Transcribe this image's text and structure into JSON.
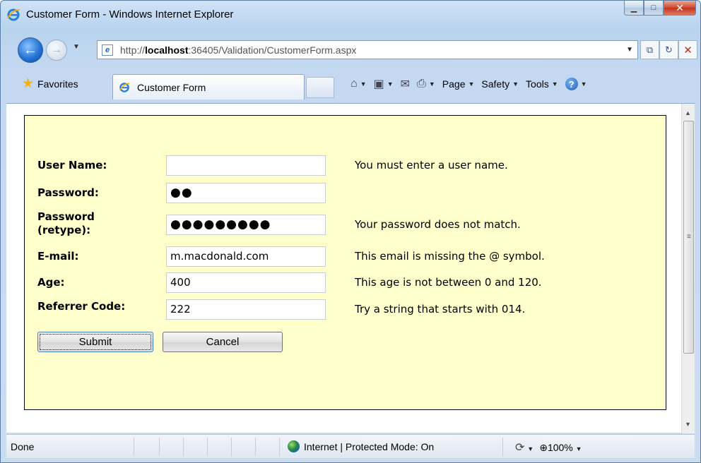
{
  "window": {
    "title": "Customer Form - Windows Internet Explorer"
  },
  "address_bar": {
    "url_prefix": "http://",
    "url_host": "localhost",
    "url_rest": ":36405/Validation/CustomerForm.aspx"
  },
  "command_bar": {
    "favorites_label": "Favorites",
    "tab_label": "Customer Form",
    "page_label": "Page",
    "safety_label": "Safety",
    "tools_label": "Tools"
  },
  "form": {
    "fields": [
      {
        "label": "User Name:",
        "value": "",
        "message": "You must enter a user name."
      },
      {
        "label": "Password:",
        "value": "●●",
        "message": ""
      },
      {
        "label": "Password (retype):",
        "value": "●●●●●●●●●",
        "message": "Your password does not match."
      },
      {
        "label": "E-mail:",
        "value": "m.macdonald.com",
        "message": "This email is missing the @ symbol."
      },
      {
        "label": "Age:",
        "value": "400",
        "message": "This age is not between 0 and 120."
      },
      {
        "label": "Referrer Code:",
        "value": "222",
        "message": "Try a string that starts with 014."
      }
    ],
    "submit_label": "Submit",
    "cancel_label": "Cancel"
  },
  "status_bar": {
    "status": "Done",
    "zone": "Internet | Protected Mode: On",
    "zoom": "100%"
  },
  "colors": {
    "panel_background": "#ffffcc",
    "window_chrome": "#c4d9f1",
    "close_button": "#c13218"
  },
  "icons": [
    "ie-logo-icon",
    "back-arrow-icon",
    "forward-arrow-icon",
    "page-icon",
    "compatibility-view-icon",
    "refresh-icon",
    "stop-icon",
    "favorites-star-icon",
    "home-icon",
    "feeds-icon",
    "mail-icon",
    "print-icon",
    "help-icon",
    "globe-icon",
    "zoom-icon"
  ]
}
